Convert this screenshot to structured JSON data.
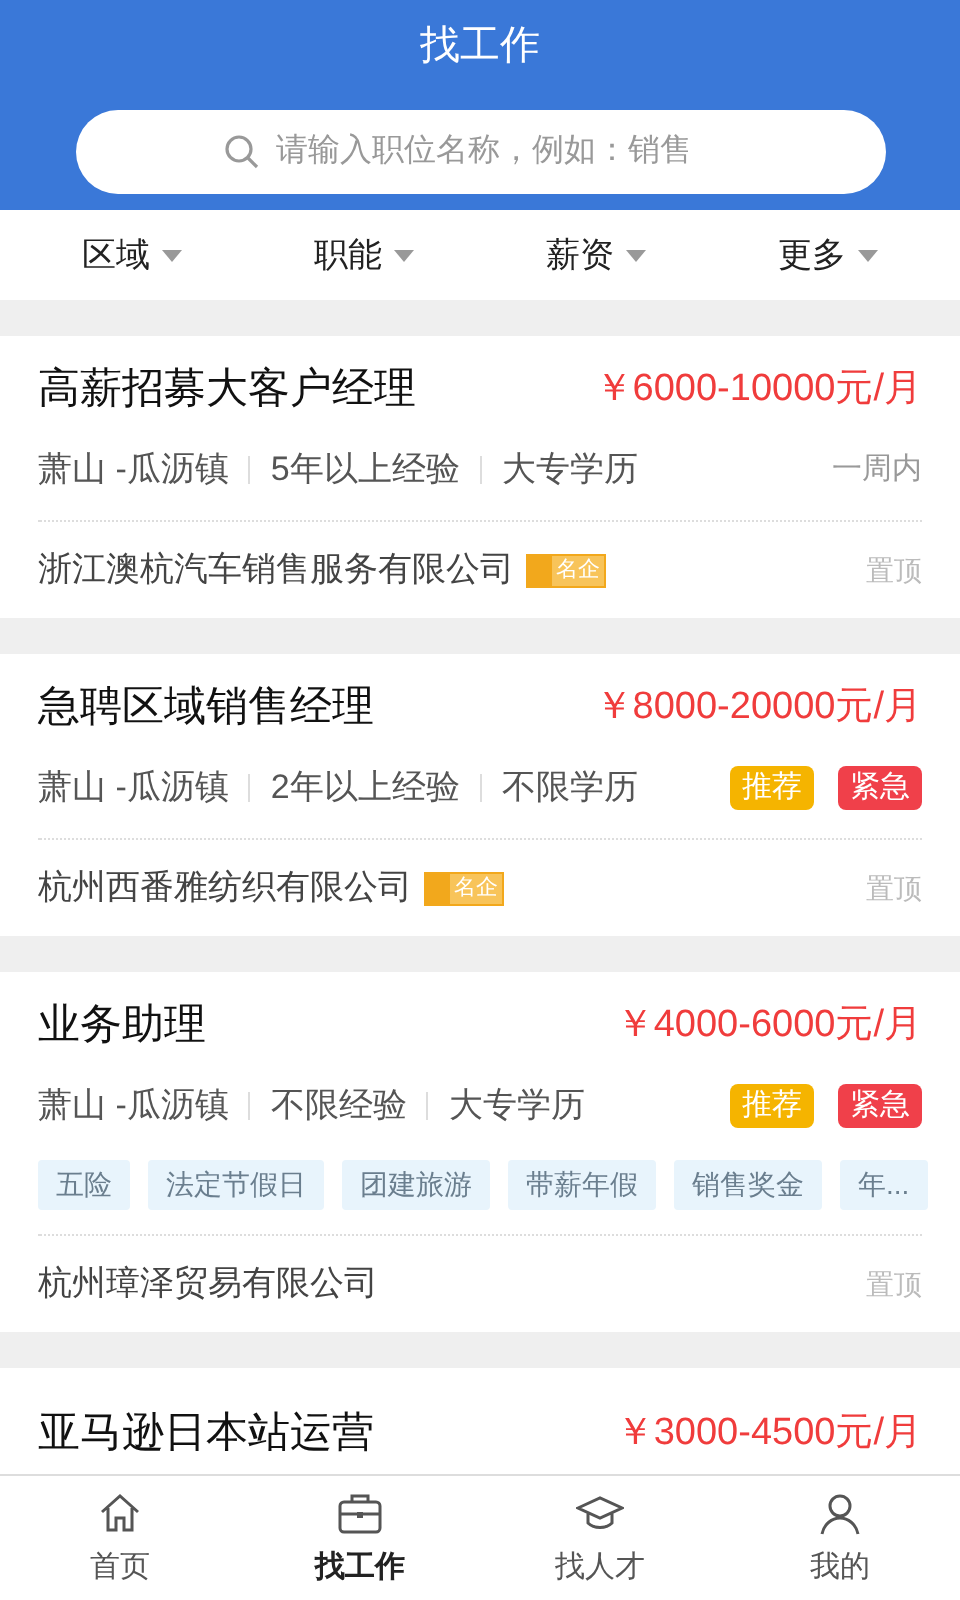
{
  "header": {
    "title": "找工作",
    "search": {
      "placeholder": "请输入职位名称，例如：销售"
    }
  },
  "filters": [
    {
      "label": "区域"
    },
    {
      "label": "职能"
    },
    {
      "label": "薪资"
    },
    {
      "label": "更多"
    }
  ],
  "jobs": [
    {
      "title": "高薪招募大客户经理",
      "salary": "￥6000-10000元/月",
      "location": "萧山 -瓜沥镇",
      "experience": "5年以上经验",
      "education": "大专学历",
      "time": "一周内",
      "company": "浙江澳杭汽车销售服务有限公司",
      "famous": "名企",
      "pin": "置顶"
    },
    {
      "title": "急聘区域销售经理",
      "salary": "￥8000-20000元/月",
      "location": "萧山 -瓜沥镇",
      "experience": "2年以上经验",
      "education": "不限学历",
      "badges": [
        {
          "kind": "recommend",
          "label": "推荐"
        },
        {
          "kind": "urgent",
          "label": "紧急"
        }
      ],
      "company": "杭州西番雅纺织有限公司",
      "famous": "名企",
      "pin": "置顶"
    },
    {
      "title": "业务助理",
      "salary": "￥4000-6000元/月",
      "location": "萧山 -瓜沥镇",
      "experience": "不限经验",
      "education": "大专学历",
      "badges": [
        {
          "kind": "recommend",
          "label": "推荐"
        },
        {
          "kind": "urgent",
          "label": "紧急"
        }
      ],
      "benefits": [
        "五险",
        "法定节假日",
        "团建旅游",
        "带薪年假",
        "销售奖金",
        "年..."
      ],
      "company": "杭州璋泽贸易有限公司",
      "pin": "置顶"
    },
    {
      "title": "亚马逊日本站运营",
      "salary": "￥3000-4500元/月"
    }
  ],
  "tabbar": [
    {
      "kind": "home",
      "label": "首页",
      "selected": false
    },
    {
      "kind": "job",
      "label": "找工作",
      "selected": true
    },
    {
      "kind": "talent",
      "label": "找人才",
      "selected": false
    },
    {
      "kind": "me",
      "label": "我的",
      "selected": false
    }
  ]
}
